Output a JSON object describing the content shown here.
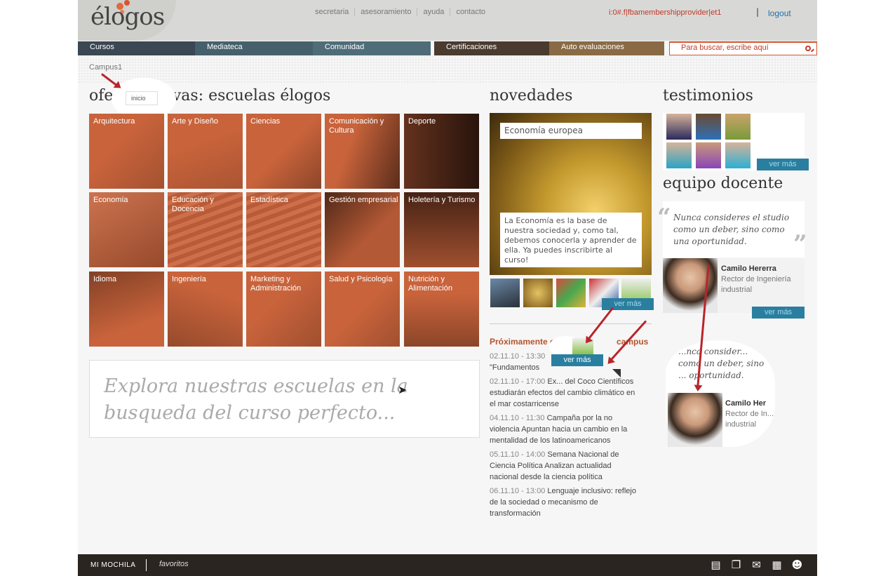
{
  "header": {
    "logo": "élogos",
    "top_links": [
      "secretaria",
      "asesoramiento",
      "ayuda",
      "contacto"
    ],
    "user": "i:0#.f|fbamembershipprovider|et1",
    "separator": "|",
    "logout": "logout"
  },
  "nav": {
    "items": [
      "Cursos",
      "Mediateca",
      "Comunidad",
      "Certificaciones",
      "Auto evaluaciones"
    ],
    "search_placeholder": "Para buscar, escribe aquí"
  },
  "breadcrumb": "Campus1",
  "inicio_tooltip": "inicio",
  "offer": {
    "title": "ofertas formativas: escuelas élogos",
    "title_visible": "ofe",
    "title_rest": "tivas: escuelas élogos",
    "schools": [
      "Arquitectura",
      "Arte y Diseño",
      "Ciencias",
      "Comunicación y Cultura",
      "Deporte",
      "Economía",
      "Educación y Docencia",
      "Estadística",
      "Gestión empresarial",
      "Holetería y Turismo",
      "Idioma",
      "Ingeniería",
      "Marketing y Administración",
      "Salud y Psicología",
      "Nutrición y Alimentación"
    ],
    "explore_text": "Explora nuestras escuelas en la busqueda del curso perfecto..."
  },
  "news": {
    "title": "novedades",
    "feature_title": "Economía europea",
    "feature_body": "La Economía es la base de nuestra sociedad y, como tal, debemos conocerla y aprender de ella. Ya puedes inscribirte al curso!",
    "ver_mas": "ver más",
    "upcoming_title": "Próximamente en ... campus",
    "upcoming_left": "Próximamente en",
    "upcoming_right": "campus",
    "events": [
      {
        "date": "02.11.10 - 13:30",
        "text": "\"Fundamentos"
      },
      {
        "date": "02.11.10 - 17:00",
        "text": "Ex... del Coco Científicos estudiarán efectos del cambio climático en el mar costarricense"
      },
      {
        "date": "04.11.10 - 11:30",
        "text": "Campaña por la no violencia Apuntan hacia un cambio en la mentalidad de los latinoamericanos"
      },
      {
        "date": "05.11.10 - 14:00",
        "text": "Semana Nacional de Ciencia Política Analizan actualidad nacional desde la ciencia política"
      },
      {
        "date": "06.11.10 - 13:00",
        "text": "Lenguaje inclusivo: reflejo de la sociedad o mecanismo de transformación"
      }
    ]
  },
  "testimonials": {
    "title": "testimonios",
    "ver_mas": "ver más"
  },
  "faculty": {
    "title": "equipo docente",
    "quote": "Nunca consideres el studio como un deber, sino como una oportunidad.",
    "name": "Camilo Hererra",
    "role": "Rector de Ingeniería industrial",
    "ver_mas": "ver más",
    "zoom_quote": "...nca consider... como un deber, sino ... oportunidad.",
    "zoom_name": "Camilo Her",
    "zoom_role": "Rector de In... industrial"
  },
  "footer": {
    "mochila": "MI MOCHILA",
    "favoritos": "favoritos"
  },
  "colors": {
    "nav_dark": "#3b4752",
    "nav_teal": "#4e6d78",
    "nav_brown": "#4a3b2f",
    "nav_tan": "#8a6a44",
    "accent_orange": "#c8633b",
    "link_blue": "#2a7fa0",
    "user_red": "#c0392b"
  }
}
